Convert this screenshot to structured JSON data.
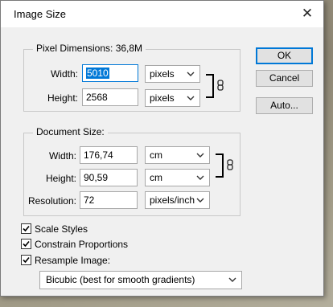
{
  "window": {
    "title": "Image Size",
    "close_glyph": "✕"
  },
  "pixel_dimensions": {
    "legend": "Pixel Dimensions:  36,8M",
    "width_label": "Width:",
    "width_value": "5010",
    "width_unit": "pixels",
    "height_label": "Height:",
    "height_value": "2568",
    "height_unit": "pixels"
  },
  "document_size": {
    "legend": "Document Size:",
    "width_label": "Width:",
    "width_value": "176,74",
    "width_unit": "cm",
    "height_label": "Height:",
    "height_value": "90,59",
    "height_unit": "cm",
    "resolution_label": "Resolution:",
    "resolution_value": "72",
    "resolution_unit": "pixels/inch"
  },
  "buttons": {
    "ok": "OK",
    "cancel": "Cancel",
    "auto": "Auto..."
  },
  "options": {
    "scale_styles": {
      "label": "Scale Styles",
      "checked": true
    },
    "constrain_proportions": {
      "label": "Constrain Proportions",
      "checked": true
    },
    "resample_image": {
      "label": "Resample Image:",
      "checked": true
    }
  },
  "resample_method": "Bicubic (best for smooth gradients)",
  "icons": {
    "link": "chain-link-icon",
    "dropdown": "chevron-down-icon",
    "check": "checkmark-icon"
  },
  "colors": {
    "accent": "#0078d7",
    "dialog_bg": "#f0f0f0"
  }
}
